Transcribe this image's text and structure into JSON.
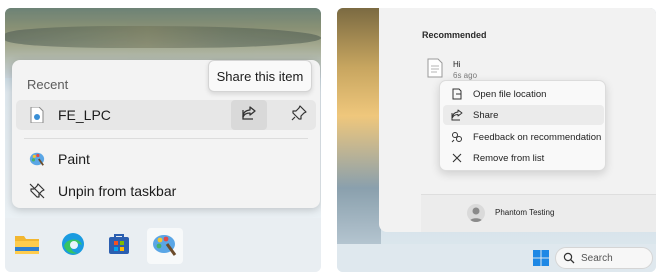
{
  "left": {
    "tooltip": "Share this item",
    "jumplist": {
      "heading": "Recent",
      "recent_item": "FE_LPC",
      "tasks": [
        "Paint",
        "Unpin from taskbar"
      ]
    },
    "taskbar_icons": [
      "file-explorer-icon",
      "edge-icon",
      "store-icon",
      "paint-icon"
    ]
  },
  "right": {
    "start_menu": {
      "heading": "Recommended",
      "file_name": "Hi",
      "file_time": "6s ago",
      "user_name": "Phantom Testing"
    },
    "context_menu": [
      "Open file location",
      "Share",
      "Feedback on recommendation",
      "Remove from list"
    ],
    "search_label": "Search"
  },
  "colors": {
    "accent": "#0067c0",
    "menu_bg": "#f3f3f3",
    "hover_bg": "#e7e7e7"
  }
}
